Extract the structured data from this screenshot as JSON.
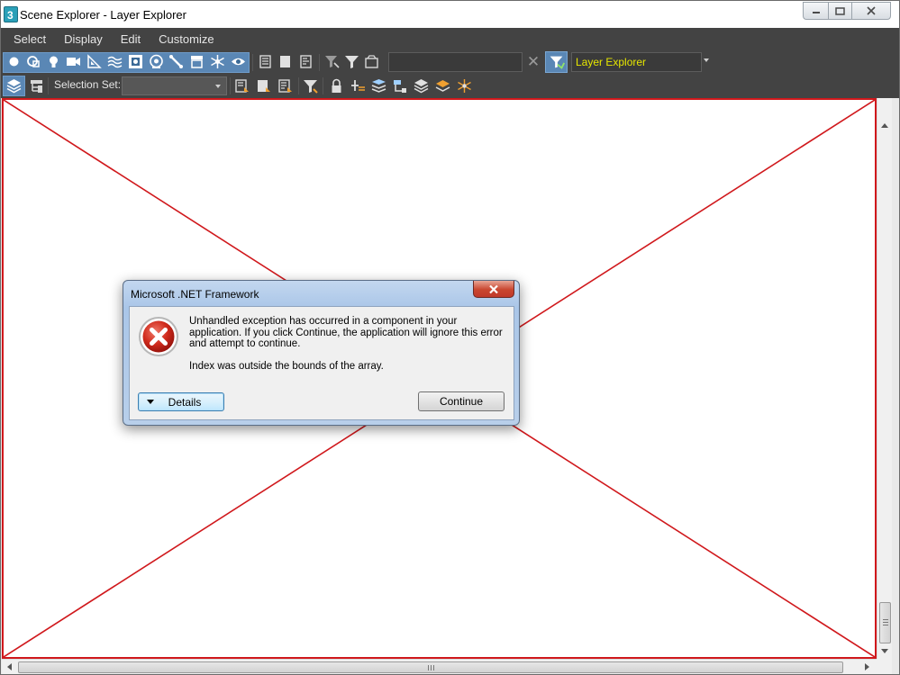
{
  "window": {
    "title": "Scene Explorer - Layer Explorer",
    "app_icon": "3ds-max-icon",
    "caption_buttons": [
      "minimize-icon",
      "maximize-icon",
      "close-icon"
    ]
  },
  "menu": {
    "items": [
      "Select",
      "Display",
      "Edit",
      "Customize"
    ]
  },
  "toolbar1": {
    "filter_icons": [
      "geometry-icon",
      "shapes-icon",
      "lights-icon",
      "cameras-icon",
      "helpers-icon",
      "space-warps-icon",
      "groups-icon",
      "xrefs-icon",
      "bones-icon",
      "containers-icon",
      "frozen-icon",
      "hidden-icon"
    ],
    "select_icons": [
      "select-all-icon",
      "select-none-icon",
      "invert-selection-icon"
    ],
    "find_icons": [
      "sync-selection-icon",
      "filter-icon",
      "display-children-icon"
    ],
    "search_value": "",
    "explorer_name": "Layer Explorer"
  },
  "toolbar2": {
    "selection_set_label": "Selection Set:",
    "selection_set_value": ""
  },
  "colors": {
    "panel": "#434343",
    "accent": "#5a87b5",
    "explorer_text": "#e6e600",
    "content_border": "#d0181c"
  },
  "dialog": {
    "title": "Microsoft .NET Framework",
    "icon": "error-icon",
    "message": "Unhandled exception has occurred in a component in your application. If you click Continue, the application will ignore this error and attempt to continue.",
    "detail": "Index was outside the bounds of the array.",
    "details_button": "Details",
    "continue_button": "Continue"
  }
}
